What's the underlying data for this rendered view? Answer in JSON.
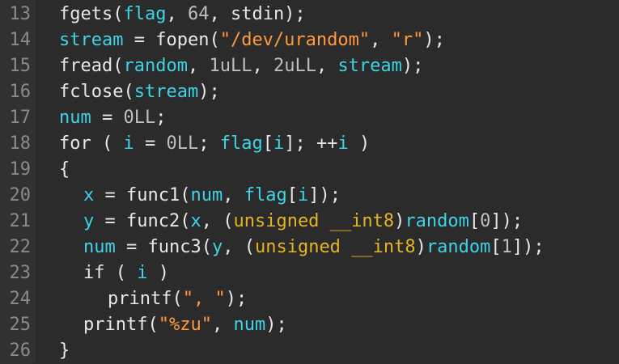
{
  "editor": {
    "lines": [
      {
        "num": "13",
        "indent": 0,
        "tokens": [
          {
            "t": "fgets(",
            "c": "default"
          },
          {
            "t": "flag",
            "c": "var"
          },
          {
            "t": ", ",
            "c": "default"
          },
          {
            "t": "64",
            "c": "num"
          },
          {
            "t": ", stdin);",
            "c": "default"
          }
        ]
      },
      {
        "num": "14",
        "indent": 0,
        "tokens": [
          {
            "t": "stream",
            "c": "var"
          },
          {
            "t": " = fopen(",
            "c": "default"
          },
          {
            "t": "\"/dev/urandom\"",
            "c": "str"
          },
          {
            "t": ", ",
            "c": "default"
          },
          {
            "t": "\"r\"",
            "c": "str"
          },
          {
            "t": ");",
            "c": "default"
          }
        ]
      },
      {
        "num": "15",
        "indent": 0,
        "tokens": [
          {
            "t": "fread(",
            "c": "default"
          },
          {
            "t": "random",
            "c": "var"
          },
          {
            "t": ", ",
            "c": "default"
          },
          {
            "t": "1uLL",
            "c": "num"
          },
          {
            "t": ", ",
            "c": "default"
          },
          {
            "t": "2uLL",
            "c": "num"
          },
          {
            "t": ", ",
            "c": "default"
          },
          {
            "t": "stream",
            "c": "var"
          },
          {
            "t": ");",
            "c": "default"
          }
        ]
      },
      {
        "num": "16",
        "indent": 0,
        "tokens": [
          {
            "t": "fclose(",
            "c": "default"
          },
          {
            "t": "stream",
            "c": "var"
          },
          {
            "t": ");",
            "c": "default"
          }
        ]
      },
      {
        "num": "17",
        "indent": 0,
        "tokens": [
          {
            "t": "num",
            "c": "var"
          },
          {
            "t": " = ",
            "c": "default"
          },
          {
            "t": "0LL",
            "c": "num"
          },
          {
            "t": ";",
            "c": "default"
          }
        ]
      },
      {
        "num": "18",
        "indent": 0,
        "tokens": [
          {
            "t": "for",
            "c": "kw"
          },
          {
            "t": " ( ",
            "c": "default"
          },
          {
            "t": "i",
            "c": "var"
          },
          {
            "t": " = ",
            "c": "default"
          },
          {
            "t": "0LL",
            "c": "num"
          },
          {
            "t": "; ",
            "c": "default"
          },
          {
            "t": "flag",
            "c": "var"
          },
          {
            "t": "[",
            "c": "default"
          },
          {
            "t": "i",
            "c": "var"
          },
          {
            "t": "]; ++",
            "c": "default"
          },
          {
            "t": "i",
            "c": "var"
          },
          {
            "t": " )",
            "c": "default"
          }
        ]
      },
      {
        "num": "19",
        "indent": 0,
        "tokens": [
          {
            "t": "{",
            "c": "default"
          }
        ]
      },
      {
        "num": "20",
        "indent": 1,
        "tokens": [
          {
            "t": "x",
            "c": "var"
          },
          {
            "t": " = func1(",
            "c": "default"
          },
          {
            "t": "num",
            "c": "var"
          },
          {
            "t": ", ",
            "c": "default"
          },
          {
            "t": "flag",
            "c": "var"
          },
          {
            "t": "[",
            "c": "default"
          },
          {
            "t": "i",
            "c": "var"
          },
          {
            "t": "]);",
            "c": "default"
          }
        ]
      },
      {
        "num": "21",
        "indent": 1,
        "tokens": [
          {
            "t": "y",
            "c": "var"
          },
          {
            "t": " = func2(",
            "c": "default"
          },
          {
            "t": "x",
            "c": "var"
          },
          {
            "t": ", (",
            "c": "default"
          },
          {
            "t": "unsigned __int8",
            "c": "type"
          },
          {
            "t": ")",
            "c": "default"
          },
          {
            "t": "random",
            "c": "var"
          },
          {
            "t": "[",
            "c": "default"
          },
          {
            "t": "0",
            "c": "num"
          },
          {
            "t": "]);",
            "c": "default"
          }
        ]
      },
      {
        "num": "22",
        "indent": 1,
        "tokens": [
          {
            "t": "num",
            "c": "var"
          },
          {
            "t": " = func3(",
            "c": "default"
          },
          {
            "t": "y",
            "c": "var"
          },
          {
            "t": ", (",
            "c": "default"
          },
          {
            "t": "unsigned __int8",
            "c": "type"
          },
          {
            "t": ")",
            "c": "default"
          },
          {
            "t": "random",
            "c": "var"
          },
          {
            "t": "[",
            "c": "default"
          },
          {
            "t": "1",
            "c": "num"
          },
          {
            "t": "]);",
            "c": "default"
          }
        ]
      },
      {
        "num": "23",
        "indent": 1,
        "tokens": [
          {
            "t": "if",
            "c": "kw"
          },
          {
            "t": " ( ",
            "c": "default"
          },
          {
            "t": "i",
            "c": "var"
          },
          {
            "t": " )",
            "c": "default"
          }
        ]
      },
      {
        "num": "24",
        "indent": 2,
        "tokens": [
          {
            "t": "printf(",
            "c": "default"
          },
          {
            "t": "\", \"",
            "c": "str"
          },
          {
            "t": ");",
            "c": "default"
          }
        ]
      },
      {
        "num": "25",
        "indent": 1,
        "tokens": [
          {
            "t": "printf(",
            "c": "default"
          },
          {
            "t": "\"%zu\"",
            "c": "str"
          },
          {
            "t": ", ",
            "c": "default"
          },
          {
            "t": "num",
            "c": "var"
          },
          {
            "t": ");",
            "c": "default"
          }
        ]
      },
      {
        "num": "26",
        "indent": 0,
        "tokens": [
          {
            "t": "}",
            "c": "default"
          }
        ]
      }
    ]
  },
  "colors": {
    "background": "#2b2b2b",
    "gutter": "#313131",
    "line_number": "#8a8a8a",
    "default_text": "#e8e8e8",
    "variable": "#3fd3e6",
    "string": "#ff9b3d",
    "number": "#bfbfbf",
    "type": "#e6b422"
  }
}
